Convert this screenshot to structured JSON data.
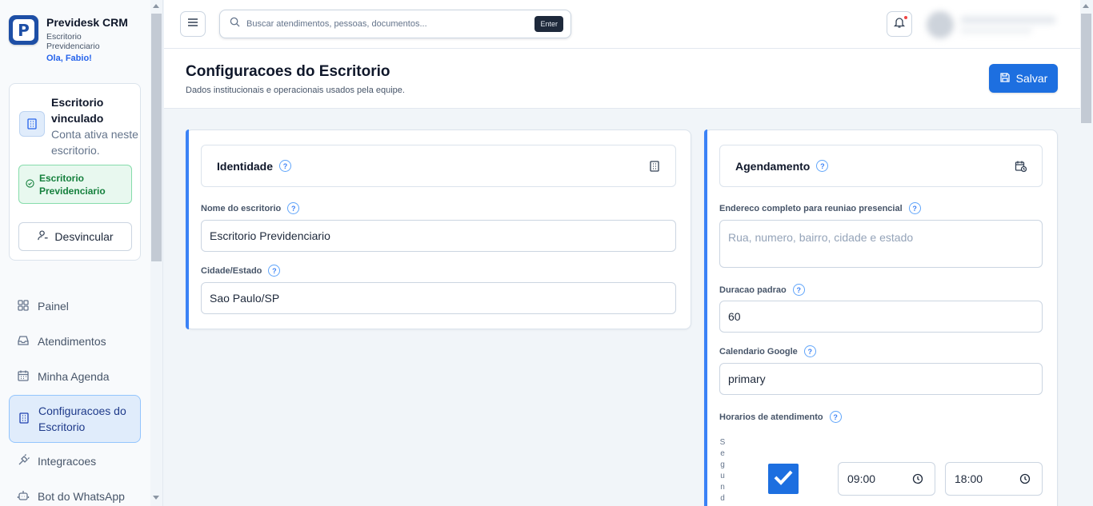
{
  "brand": {
    "name": "Previdesk CRM",
    "logo_letter": "P",
    "subtitle": "Escritorio Previdenciario",
    "greeting": "Ola, Fabio!"
  },
  "office_card": {
    "title": "Escritorio vinculado",
    "subtitle": "Conta ativa neste escritorio.",
    "badge": "Escritorio Previdenciario",
    "unlink_label": "Desvincular"
  },
  "nav": {
    "items": [
      {
        "label": "Painel",
        "icon": "grid-icon"
      },
      {
        "label": "Atendimentos",
        "icon": "inbox-icon"
      },
      {
        "label": "Minha Agenda",
        "icon": "calendar-icon"
      },
      {
        "label": "Configuracoes do Escritorio",
        "icon": "building-icon",
        "active": true
      },
      {
        "label": "Integracoes",
        "icon": "plug-icon"
      },
      {
        "label": "Bot do WhatsApp",
        "icon": "bot-icon"
      }
    ]
  },
  "topbar": {
    "search_placeholder": "Buscar atendimentos, pessoas, documentos...",
    "enter_key": "Enter"
  },
  "header": {
    "title": "Configuracoes do Escritorio",
    "subtitle": "Dados institucionais e operacionais usados pela equipe.",
    "save_label": "Salvar"
  },
  "identity": {
    "title": "Identidade",
    "name_label": "Nome do escritorio",
    "name_value": "Escritorio Previdenciario",
    "city_label": "Cidade/Estado",
    "city_value": "Sao Paulo/SP"
  },
  "scheduling": {
    "title": "Agendamento",
    "address_label": "Endereco completo para reuniao presencial",
    "address_placeholder": "Rua, numero, bairro, cidade e estado",
    "duration_label": "Duracao padrao",
    "duration_value": "60",
    "calendar_label": "Calendario Google",
    "calendar_value": "primary",
    "hours_label": "Horarios de atendimento",
    "day_label": "Segund",
    "start_time": "09:00",
    "end_time": "18:00",
    "day_enabled": true
  },
  "colors": {
    "primary": "#1d6fe0",
    "accent_bar": "#3b82f6",
    "success": "#15803d",
    "notification": "#ef4444"
  }
}
